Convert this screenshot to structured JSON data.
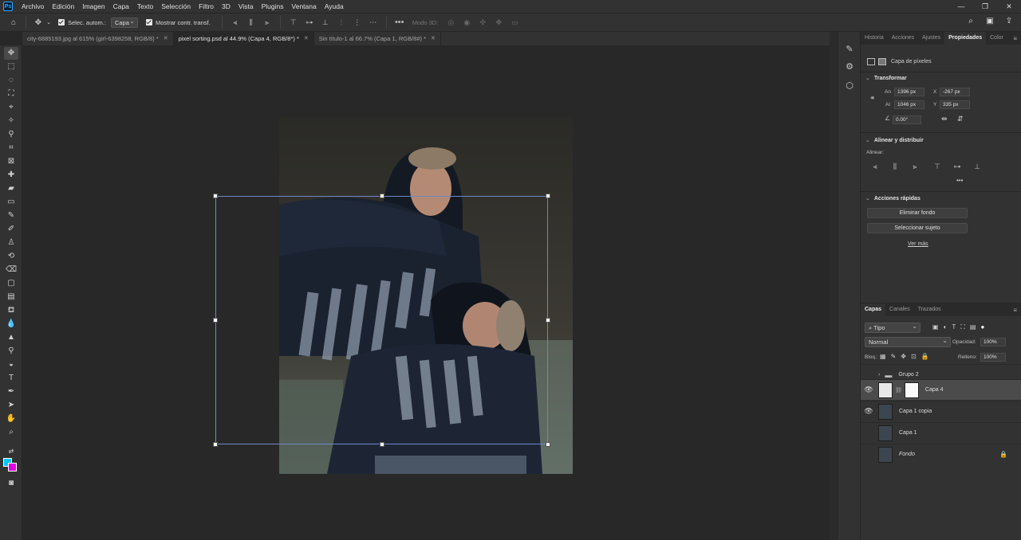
{
  "menubar": {
    "items": [
      "Archivo",
      "Edición",
      "Imagen",
      "Capa",
      "Texto",
      "Selección",
      "Filtro",
      "3D",
      "Vista",
      "Plugins",
      "Ventana",
      "Ayuda"
    ],
    "window_controls": [
      "—",
      "❐",
      "✕"
    ]
  },
  "options_bar": {
    "auto_select_label": "Selec. autom.:",
    "auto_select_value": "Capa",
    "show_transform_label": "Mostrar contr. transf.",
    "mode_3d_label": "Modo 3D:"
  },
  "tabs": [
    {
      "label": "city-6885193.jpg al 615% (girl-6398258, RGB/8) *",
      "active": false
    },
    {
      "label": "pixel sorting.psd al 44.9% (Capa 4, RGB/8*) *",
      "active": true
    },
    {
      "label": "Sin título-1 al 66.7% (Capa 1, RGB/8#) *",
      "active": false
    }
  ],
  "colors": {
    "foreground": "#00c8ff",
    "background": "#e300e3",
    "transform_box": "#6f86c8"
  },
  "properties_panel": {
    "tabs": [
      "Historia",
      "Acciones",
      "Ajustes",
      "Propiedades",
      "Color"
    ],
    "active_tab": "Propiedades",
    "layer_type": "Capa de píxeles",
    "transform": {
      "title": "Transformar",
      "w_label": "An",
      "w_value": "1396 px",
      "h_label": "Al",
      "h_value": "1046 px",
      "x_label": "X",
      "x_value": "-267 px",
      "y_label": "Y",
      "y_value": "335 px",
      "angle_value": "0.00°"
    },
    "align": {
      "title": "Alinear y distribuir",
      "subtitle": "Alinear:"
    },
    "quick_actions": {
      "title": "Acciones rápidas",
      "remove_bg": "Eliminar fondo",
      "select_subject": "Seleccionar sujeto",
      "see_more": "Ver más"
    }
  },
  "layers_panel": {
    "tabs": [
      "Capas",
      "Canales",
      "Trazados"
    ],
    "active_tab": "Capas",
    "filter_kind": "Tipo",
    "blend_mode": "Normal",
    "opacity_label": "Opacidad:",
    "opacity_value": "100%",
    "lock_label": "Bloq.:",
    "fill_label": "Relleno:",
    "fill_value": "100%",
    "layers": [
      {
        "name": "Grupo 2",
        "visible": false,
        "type": "group"
      },
      {
        "name": "Capa 4",
        "visible": true,
        "type": "pixel_mask",
        "selected": true
      },
      {
        "name": "Capa 1 copia",
        "visible": true,
        "type": "pixel"
      },
      {
        "name": "Capa 1",
        "visible": false,
        "type": "pixel"
      },
      {
        "name": "Fondo",
        "visible": false,
        "type": "background",
        "locked": true
      }
    ]
  }
}
